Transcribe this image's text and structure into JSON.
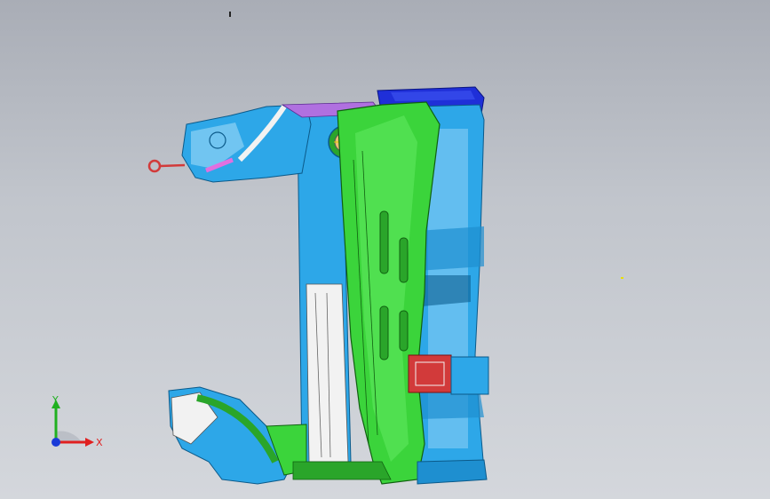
{
  "viewport": {
    "title": "",
    "background_top": "#a9adb6",
    "background_bottom": "#d4d7dc"
  },
  "model": {
    "name": "",
    "colors": {
      "main_member": "#3bd43b",
      "sub_member": "#2aa52a",
      "frame": "#2da7e8",
      "frame_light": "#8fd2f5",
      "bracket_top": "#1f2fd8",
      "insert_red": "#d23a3a",
      "white_panel": "#f2f2f2",
      "purple_bracket": "#b070e0",
      "pink_line": "#e070e0"
    }
  },
  "triad": {
    "x_label": "X",
    "y_label": "Y",
    "x_color": "#e02020",
    "y_color": "#20b020",
    "origin_color": "#1a3bd8"
  }
}
